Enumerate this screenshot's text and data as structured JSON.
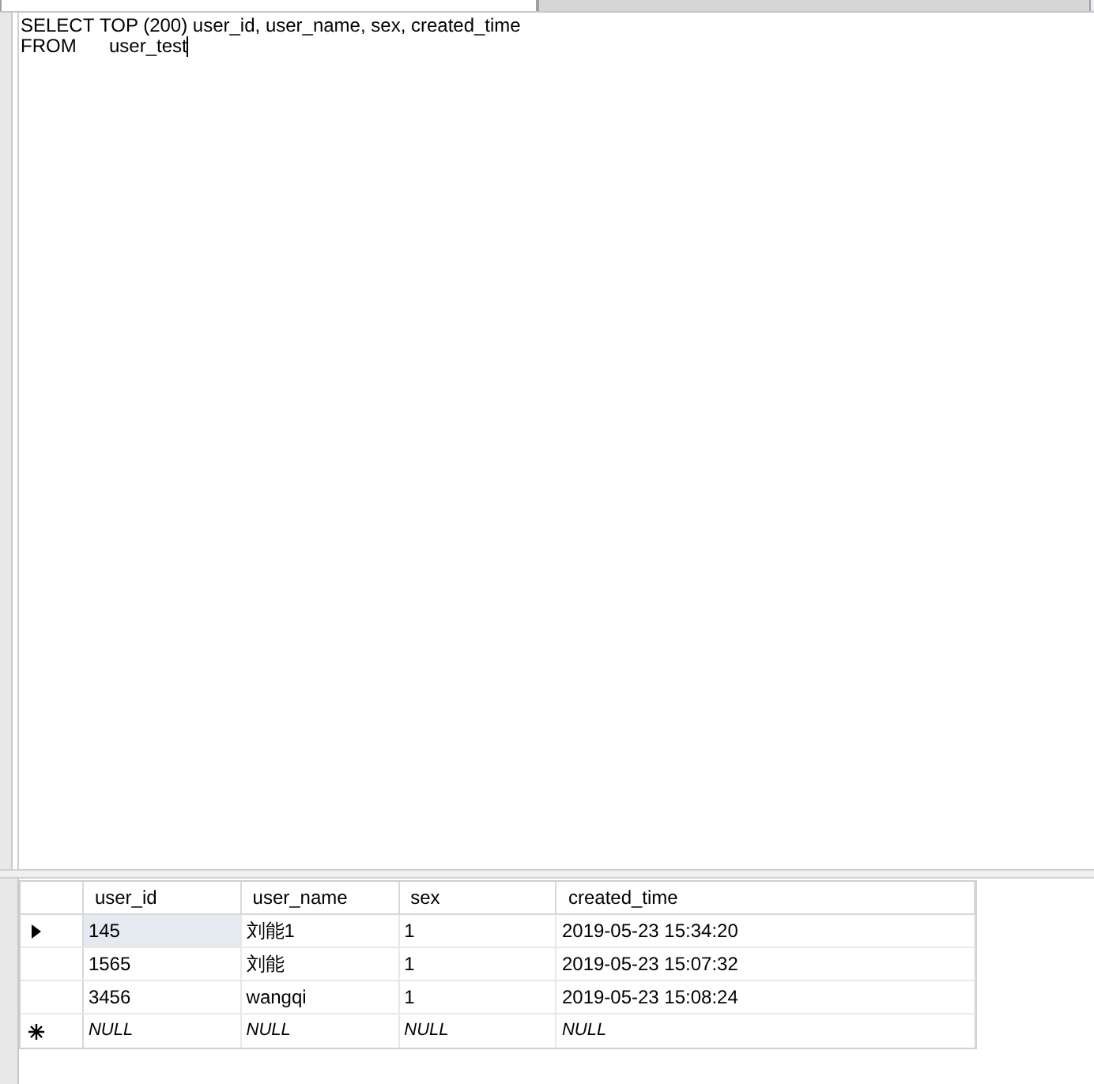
{
  "tabs": [
    {
      "selected": true
    },
    {
      "selected": false
    }
  ],
  "editor": {
    "lines": [
      {
        "keyword": "SELECT",
        "text": "TOP (200) user_id, user_name, sex, created_time"
      },
      {
        "keyword": "FROM",
        "text": "user_test"
      }
    ],
    "cursor": true
  },
  "grid": {
    "columns": [
      "user_id",
      "user_name",
      "sex",
      "created_time"
    ],
    "rows": [
      {
        "kind": "current",
        "cells": [
          {
            "text": "145",
            "selected": true,
            "kind": "value"
          },
          {
            "text": "刘能1",
            "selected": false,
            "kind": "value"
          },
          {
            "text": "1",
            "selected": false,
            "kind": "value"
          },
          {
            "text": "2019-05-23 15:34:20",
            "selected": false,
            "kind": "value"
          }
        ]
      },
      {
        "kind": "data",
        "cells": [
          {
            "text": "1565",
            "selected": false,
            "kind": "value"
          },
          {
            "text": "刘能",
            "selected": false,
            "kind": "value"
          },
          {
            "text": "1",
            "selected": false,
            "kind": "value"
          },
          {
            "text": "2019-05-23 15:07:32",
            "selected": false,
            "kind": "value"
          }
        ]
      },
      {
        "kind": "data",
        "cells": [
          {
            "text": "3456",
            "selected": false,
            "kind": "value"
          },
          {
            "text": "wangqi",
            "selected": false,
            "kind": "value"
          },
          {
            "text": "1",
            "selected": false,
            "kind": "value"
          },
          {
            "text": "2019-05-23 15:08:24",
            "selected": false,
            "kind": "value"
          }
        ]
      },
      {
        "kind": "new",
        "cells": [
          {
            "text": "NULL",
            "selected": false,
            "kind": "null"
          },
          {
            "text": "NULL",
            "selected": false,
            "kind": "null"
          },
          {
            "text": "NULL",
            "selected": false,
            "kind": "null"
          },
          {
            "text": "NULL",
            "selected": false,
            "kind": "null"
          }
        ]
      }
    ]
  }
}
